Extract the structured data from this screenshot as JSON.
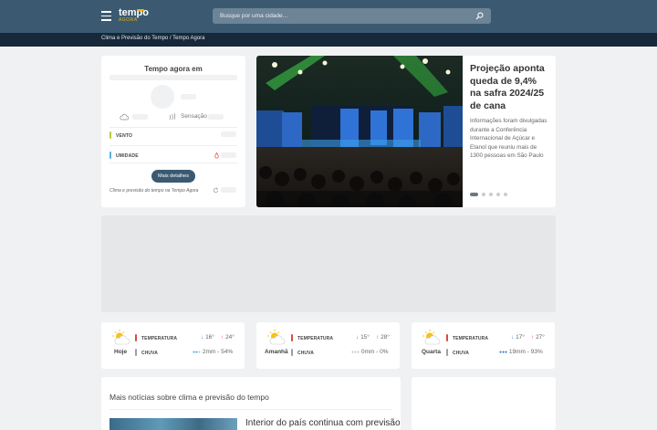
{
  "header": {
    "logo_text": "tempo",
    "logo_sub": "AGORA",
    "search_placeholder": "Busque por uma cidade..."
  },
  "breadcrumb": "Clima e Previsão do Tempo / Tempo Agora",
  "now": {
    "title": "Tempo agora em",
    "sensation_label": "Sensação",
    "wind_label": "VENTO",
    "humidity_label": "UMIDADE",
    "details_button": "Mais detalhes",
    "footer": "Clima e previsão do tempo na Tempo Agora"
  },
  "featured": {
    "title": "Projeção aponta queda de 9,4% na safra 2024/25 de cana",
    "description": "Informações foram divulgadas durante a Conferência Internacional de Açúcar e Etanol que reuniu mais de 1300 pessoas em São Paulo",
    "slides": 5,
    "active_slide": 1
  },
  "forecast": {
    "temp_label": "TEMPERATURA",
    "rain_label": "CHUVA",
    "days": [
      {
        "name": "Hoje",
        "min": "16°",
        "max": "24°",
        "rain": "2mm - 54%"
      },
      {
        "name": "Amanhã",
        "min": "15°",
        "max": "28°",
        "rain": "0mm - 0%"
      },
      {
        "name": "Quarta",
        "min": "17°",
        "max": "27°",
        "rain": "19mm - 93%"
      }
    ]
  },
  "more_news": {
    "title": "Mais notícias sobre clima e previsão do tempo",
    "headline": "Interior do país continua com previsão"
  },
  "colors": {
    "header": "#3b5a72",
    "subbar": "#16283a",
    "temp_bar": "#d84b3b",
    "rain_bar": "#9aa0a6",
    "wind_bar": "#b8c84a",
    "humidity_bar": "#5aaee0"
  }
}
